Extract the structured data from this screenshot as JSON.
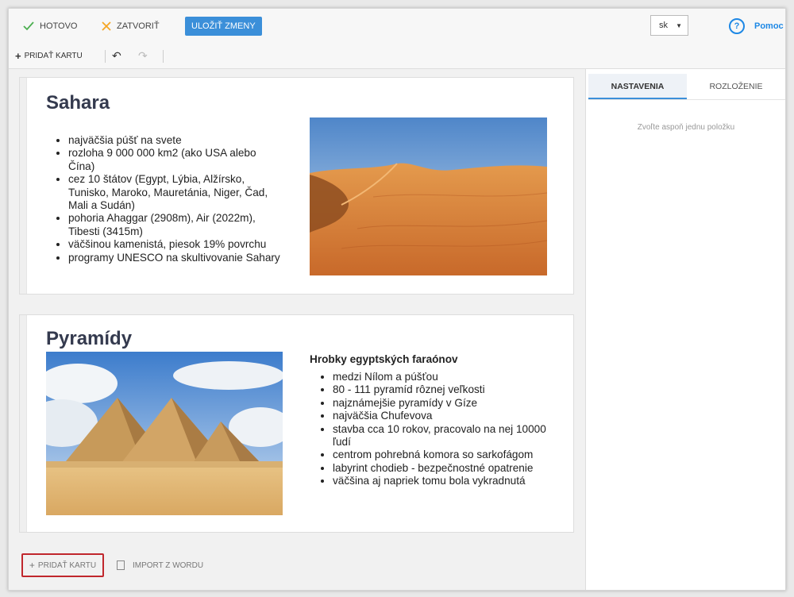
{
  "topbar": {
    "done_label": "HOTOVO",
    "close_label": "ZATVORIŤ",
    "save_label": "ULOŽIŤ ZMENY",
    "language": "sk",
    "help_label": "Pomoc",
    "colors": {
      "done": "#4caf50",
      "close": "#f5a623",
      "save_bg": "#3b8fd9",
      "help": "#1e88e5"
    }
  },
  "toolbar": {
    "add_card_label": "PRIDAŤ KARTU",
    "undo_icon": "undo-icon",
    "redo_icon": "redo-icon"
  },
  "cards": [
    {
      "title": "Sahara",
      "bullets": [
        "najväčšia púšť na svete",
        "rozloha 9 000 000 km2 (ako USA alebo Čína)",
        "cez 10 štátov (Egypt, Lýbia, Alžírsko, Tunisko, Maroko, Mauretánia, Niger, Čad, Mali a Sudán)",
        "pohoria Ahaggar (2908m), Air (2022m), Tibesti (3415m)",
        "väčšinou kamenistá, piesok 19% povrchu",
        "programy UNESCO na skultivovanie Sahary"
      ],
      "image": "sahara-dunes"
    },
    {
      "title": "Pyramídy",
      "subtitle": "Hrobky egyptských faraónov",
      "bullets": [
        "medzi Nílom a púšťou",
        "80 - 111 pyramíd rôznej veľkosti",
        "najznámejšie pyramídy v Gíze",
        "najväčšia Chufevova",
        "stavba cca 10 rokov, pracovalo na nej 10000 ľudí",
        "centrom pohrebná komora so sarkofágom",
        "labyrint chodieb - bezpečnostné opatrenie",
        "väčšina aj napriek tomu bola vykradnutá"
      ],
      "image": "giza-pyramids"
    }
  ],
  "bottom": {
    "add_card_label": "PRIDAŤ KARTU",
    "import_label": "IMPORT Z WORDU",
    "highlight_color": "#c0272d"
  },
  "sidebar": {
    "tabs": [
      {
        "label": "NASTAVENIA",
        "active": true
      },
      {
        "label": "ROZLOŽENIE",
        "active": false
      }
    ],
    "hint": "Zvoľte aspoň jednu položku"
  }
}
